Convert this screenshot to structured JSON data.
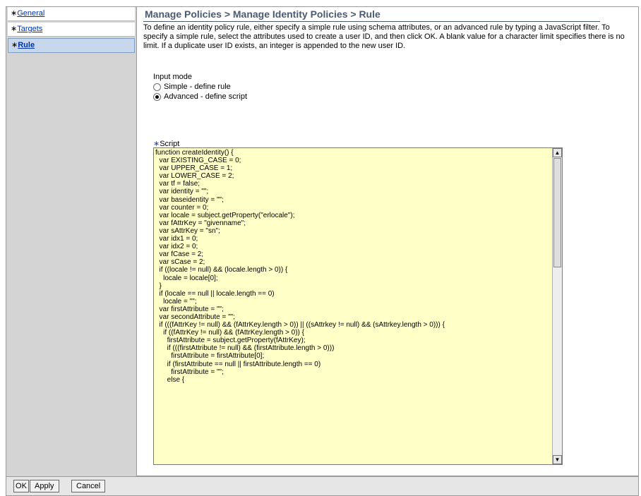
{
  "nav": {
    "items": [
      {
        "label": "General",
        "required_mark": "∗"
      },
      {
        "label": "Targets",
        "required_mark": "∗"
      },
      {
        "label": "Rule",
        "required_mark": "∗"
      }
    ]
  },
  "main": {
    "title": "Manage Policies > Manage Identity Policies > Rule",
    "description": "To define an identity policy rule, either specify a simple rule using schema attributes, or an advanced rule by typing a JavaScript filter. To specify a simple rule, select the attributes used to create a user ID, and then click OK. A blank value for a character limit specifies there is no limit. If a duplicate user ID exists, an integer is appended to the new user ID.",
    "input_mode": {
      "label": "Input mode",
      "options": [
        {
          "label": "Simple - define rule",
          "selected": false
        },
        {
          "label": "Advanced - define script",
          "selected": true
        }
      ]
    },
    "script": {
      "label": "Script",
      "required_mark": "∗",
      "value": "function createIdentity() {\n  var EXISTING_CASE = 0;\n  var UPPER_CASE = 1;\n  var LOWER_CASE = 2;\n  var tf = false;\n  var identity = \"\";\n  var baseidentity = \"\";\n  var counter = 0;\n  var locale = subject.getProperty(\"erlocale\");\n  var fAttrKey = \"givenname\";\n  var sAttrKey = \"sn\";\n  var idx1 = 0;\n  var idx2 = 0;\n  var fCase = 2;\n  var sCase = 2;\n  if ((locale != null) && (locale.length > 0)) {\n    locale = locale[0];\n  }\n  if (locale == null || locale.length == 0)\n    locale = \"\";\n  var firstAttribute = \"\";\n  var secondAttribute = \"\";\n  if (((fAttrKey != null) && (fAttrKey.length > 0)) || ((sAttrkey != null) && (sAttrkey.length > 0))) {\n    if ((fAttrKey != null) && (fAttrKey.length > 0)) {\n      firstAttribute = subject.getProperty(fAttrKey);\n      if (((firstAttribute != null) && (firstAttribute.length > 0)))\n        firstAttribute = firstAttribute[0];\n      if (firstAttribute == null || firstAttribute.length == 0)\n        firstAttribute = \"\";\n      else {"
    }
  },
  "footer": {
    "ok_label": "OK",
    "apply_label": "Apply",
    "cancel_label": "Cancel"
  },
  "colors": {
    "title": "#4b5a70",
    "link": "#0033aa",
    "script_bg": "#ffffc8",
    "sidebar_bg": "#d4d4d4",
    "active_nav_bg": "#c8d8ec"
  },
  "icons": {
    "radio": "radio-button",
    "scroll_up": "scroll-up-arrow",
    "scroll_down": "scroll-down-arrow",
    "cursor": "mouse-pointer"
  }
}
